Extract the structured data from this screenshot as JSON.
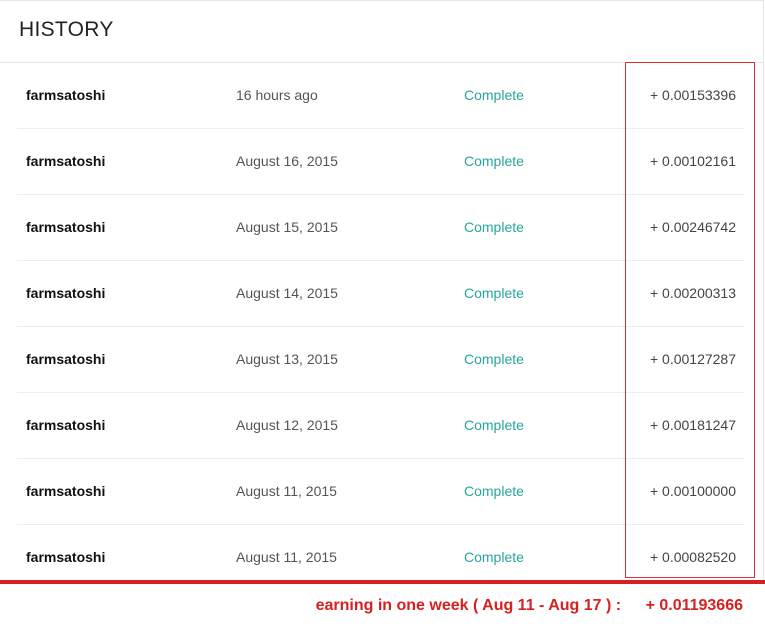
{
  "header": {
    "title": "HISTORY"
  },
  "history": [
    {
      "user": "farmsatoshi",
      "date": "16 hours ago",
      "status": "Complete",
      "amount": "+ 0.00153396"
    },
    {
      "user": "farmsatoshi",
      "date": "August 16, 2015",
      "status": "Complete",
      "amount": "+ 0.00102161"
    },
    {
      "user": "farmsatoshi",
      "date": "August 15, 2015",
      "status": "Complete",
      "amount": "+ 0.00246742"
    },
    {
      "user": "farmsatoshi",
      "date": "August 14, 2015",
      "status": "Complete",
      "amount": "+ 0.00200313"
    },
    {
      "user": "farmsatoshi",
      "date": "August 13, 2015",
      "status": "Complete",
      "amount": "+ 0.00127287"
    },
    {
      "user": "farmsatoshi",
      "date": "August 12, 2015",
      "status": "Complete",
      "amount": "+ 0.00181247"
    },
    {
      "user": "farmsatoshi",
      "date": "August 11, 2015",
      "status": "Complete",
      "amount": "+ 0.00100000"
    },
    {
      "user": "farmsatoshi",
      "date": "August 11, 2015",
      "status": "Complete",
      "amount": "+ 0.00082520"
    }
  ],
  "summary": {
    "label": "earning in one week ( Aug 11 - Aug 17 ) :",
    "total": "+ 0.01193666"
  },
  "colors": {
    "status_complete": "#26a69a",
    "annotation_red": "#d92020"
  }
}
